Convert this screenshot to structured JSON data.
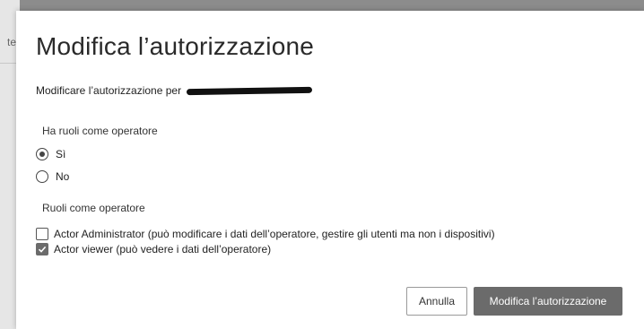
{
  "background": {
    "partial_text": "te"
  },
  "dialog": {
    "title": "Modifica l’autorizzazione",
    "subtitle": "Modificare l’autorizzazione per",
    "operator_question": {
      "label": "Ha ruoli come operatore",
      "options": [
        {
          "label": "Sì",
          "selected": true
        },
        {
          "label": "No",
          "selected": false
        }
      ]
    },
    "roles": {
      "label": "Ruoli come operatore",
      "items": [
        {
          "label": "Actor Administrator (può modificare i dati dell’operatore, gestire gli utenti ma non i dispositivi)",
          "checked": false
        },
        {
          "label": "Actor viewer (può vedere i dati dell’operatore)",
          "checked": true
        }
      ]
    },
    "buttons": {
      "cancel": "Annulla",
      "submit": "Modifica l’autorizzazione"
    }
  },
  "colors": {
    "primary_button": "#6b6b6b",
    "overlay": "#8c8c8c"
  }
}
